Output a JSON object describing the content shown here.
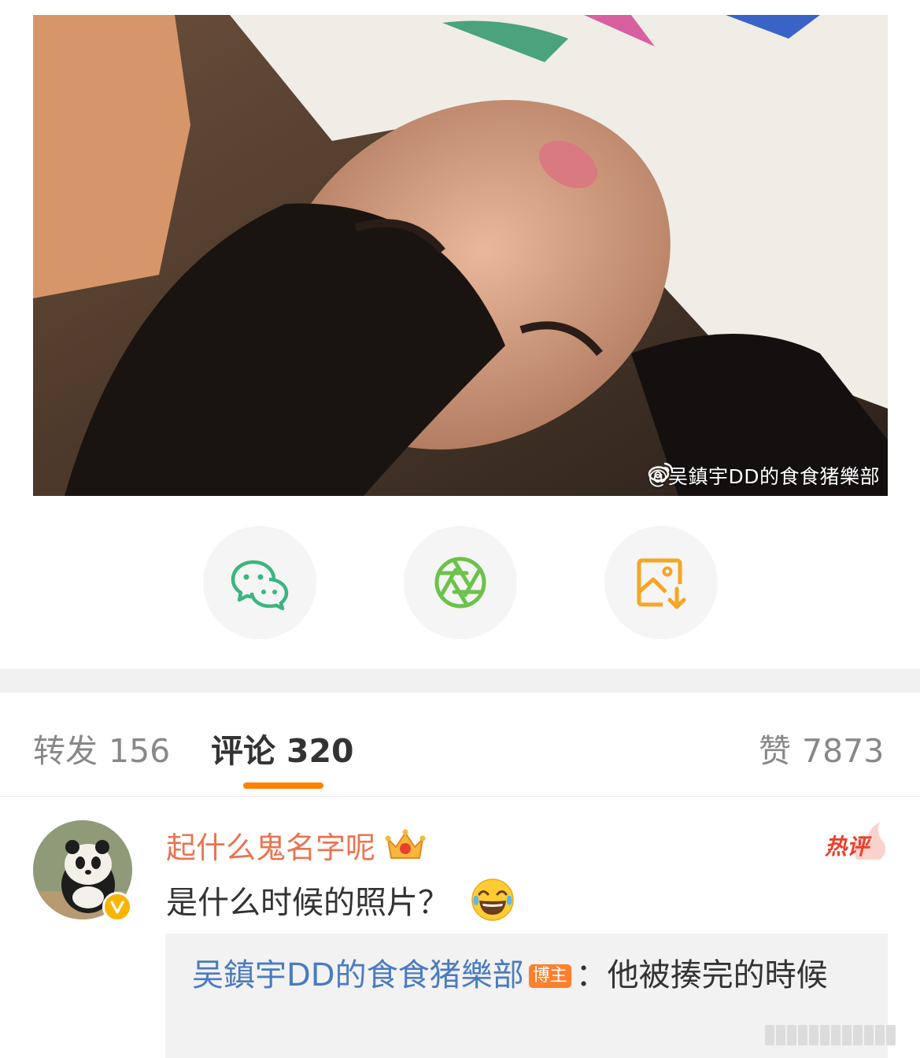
{
  "post": {
    "watermark": "@吴鎮宇DD的食食猪樂部"
  },
  "share": {
    "items": [
      {
        "icon": "wechat-icon"
      },
      {
        "icon": "moments-icon"
      },
      {
        "icon": "save-image-icon"
      }
    ]
  },
  "tabs": {
    "repost_label": "转发",
    "repost_count": "156",
    "comment_label": "评论",
    "comment_count": "320",
    "like_label": "赞",
    "like_count": "7873"
  },
  "comment": {
    "username": "起什么鬼名字呢",
    "text": "是什么时候的照片？",
    "hot_label": "热评",
    "reply": {
      "author": "吴鎮宇DD的食食猪樂部",
      "badge": "博主",
      "text": "：他被揍完的時候"
    }
  },
  "colors": {
    "accent": "#ff8200",
    "username": "#eb7350",
    "reply_author": "#4b7bbf",
    "wechat": "#3bb57f",
    "moments": "#6cc24a",
    "save": "#f5a623"
  }
}
